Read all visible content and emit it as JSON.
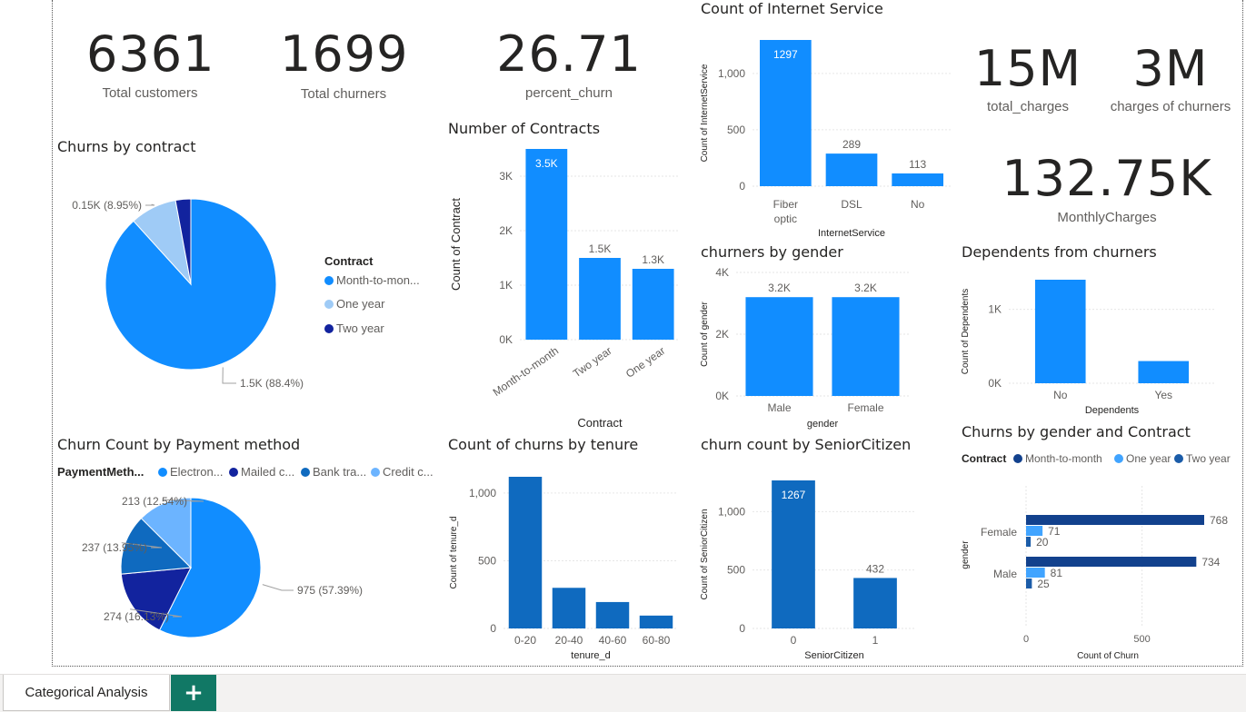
{
  "kpis": {
    "total_customers": {
      "value": "6361",
      "label": "Total customers"
    },
    "total_churners": {
      "value": "1699",
      "label": "Total churners"
    },
    "percent_churn": {
      "value": "26.71",
      "label": "percent_churn"
    },
    "total_charges": {
      "value": "15M",
      "label": "total_charges"
    },
    "charges_churners": {
      "value": "3M",
      "label": "charges of churners"
    },
    "monthly_charges": {
      "value": "132.75K",
      "label": "MonthlyCharges"
    }
  },
  "tabs": {
    "page": "Categorical Analysis",
    "add": "+"
  },
  "colors": {
    "primary": "#118dff",
    "dark": "#12239e",
    "light": "#6cb4ff",
    "mid": "#0f6abf",
    "navy": "#1b4b85"
  },
  "chart_data": [
    {
      "id": "churns_by_contract",
      "type": "pie",
      "title": "Churns by contract",
      "legend_title": "Contract",
      "legend": [
        "Month-to-mon...",
        "One year",
        "Two year"
      ],
      "legend_position": "right",
      "categories": [
        "Month-to-month",
        "One year",
        "Two year"
      ],
      "values": [
        1500,
        150,
        49
      ],
      "percent_labels": [
        "1.5K (88.4%)",
        "0.15K (8.95%)",
        ""
      ],
      "colors": [
        "#118dff",
        "#9fcbf6",
        "#12239e"
      ]
    },
    {
      "id": "number_of_contracts",
      "type": "bar",
      "title": "Number of Contracts",
      "xlabel": "Contract",
      "ylabel": "Count of Contract",
      "categories": [
        "Month-to-month",
        "Two year",
        "One year"
      ],
      "values": [
        3500,
        1500,
        1300
      ],
      "data_labels": [
        "3.5K",
        "1.5K",
        "1.3K"
      ],
      "yticks": [
        "0K",
        "1K",
        "2K",
        "3K"
      ],
      "ylim": [
        0,
        3500
      ]
    },
    {
      "id": "internet_service",
      "type": "bar",
      "title": "Count of Internet Service",
      "xlabel": "InternetService",
      "ylabel": "Count of InternetService",
      "categories": [
        "Fiber optic",
        "DSL",
        "No"
      ],
      "category_lines": [
        [
          "Fiber",
          "optic"
        ],
        [
          "DSL"
        ],
        [
          "No"
        ]
      ],
      "values": [
        1297,
        289,
        113
      ],
      "data_labels": [
        "1297",
        "289",
        "113"
      ],
      "yticks": [
        "0",
        "500",
        "1,000"
      ],
      "ylim": [
        0,
        1297
      ]
    },
    {
      "id": "churners_by_gender",
      "type": "bar",
      "title": "churners by gender",
      "xlabel": "gender",
      "ylabel": "Count of gender",
      "categories": [
        "Male",
        "Female"
      ],
      "values": [
        3200,
        3200
      ],
      "data_labels": [
        "3.2K",
        "3.2K"
      ],
      "yticks": [
        "0K",
        "2K",
        "4K"
      ],
      "ylim": [
        0,
        4000
      ]
    },
    {
      "id": "dependents",
      "type": "bar",
      "title": "Dependents from churners",
      "xlabel": "Dependents",
      "ylabel": "Count of Dependents",
      "categories": [
        "No",
        "Yes"
      ],
      "values": [
        1400,
        300
      ],
      "yticks": [
        "0K",
        "1K"
      ],
      "ylim": [
        0,
        1400
      ]
    },
    {
      "id": "payment_method",
      "type": "pie",
      "title": "Churn Count by Payment method",
      "legend_title": "PaymentMeth...",
      "legend": [
        "Electron...",
        "Mailed c...",
        "Bank tra...",
        "Credit c..."
      ],
      "legend_position": "top",
      "categories": [
        "Electronic check",
        "Mailed check",
        "Bank transfer",
        "Credit card"
      ],
      "values": [
        975,
        274,
        237,
        213
      ],
      "percent_labels": [
        "975 (57.39%)",
        "274 (16.13%)",
        "237 (13.95%)",
        "213 (12.54%)"
      ],
      "colors": [
        "#118dff",
        "#12239e",
        "#0f6abf",
        "#6cb4ff"
      ]
    },
    {
      "id": "tenure",
      "type": "bar",
      "title": "Count of churns by tenure",
      "xlabel": "tenure_d",
      "ylabel": "Count of tenure_d",
      "categories": [
        "0-20",
        "20-40",
        "40-60",
        "60-80"
      ],
      "values": [
        1120,
        300,
        195,
        95
      ],
      "yticks": [
        "0",
        "500",
        "1,000"
      ],
      "ylim": [
        0,
        1120
      ]
    },
    {
      "id": "senior_citizen",
      "type": "bar",
      "title": "churn count by SeniorCitizen",
      "xlabel": "SeniorCitizen",
      "ylabel": "Count of SeniorCitizen",
      "categories": [
        "0",
        "1"
      ],
      "values": [
        1267,
        432
      ],
      "data_labels": [
        "1267",
        "432"
      ],
      "yticks": [
        "0",
        "500",
        "1,000"
      ],
      "ylim": [
        0,
        1267
      ]
    },
    {
      "id": "gender_contract",
      "type": "bar",
      "orientation": "horizontal",
      "title": "Churns by gender and Contract",
      "legend_title": "Contract",
      "legend": [
        "Month-to-month",
        "One year",
        "Two year"
      ],
      "legend_position": "top",
      "xlabel": "Count of Churn",
      "ylabel": "gender",
      "categories": [
        "Female",
        "Male"
      ],
      "series": [
        {
          "name": "Month-to-month",
          "values": [
            768,
            734
          ],
          "color": "#12418d"
        },
        {
          "name": "One year",
          "values": [
            71,
            81
          ],
          "color": "#41a4ff"
        },
        {
          "name": "Two year",
          "values": [
            20,
            25
          ],
          "color": "#1b5ca8"
        }
      ],
      "xticks": [
        "0",
        "500"
      ],
      "xlim": [
        0,
        768
      ]
    }
  ]
}
